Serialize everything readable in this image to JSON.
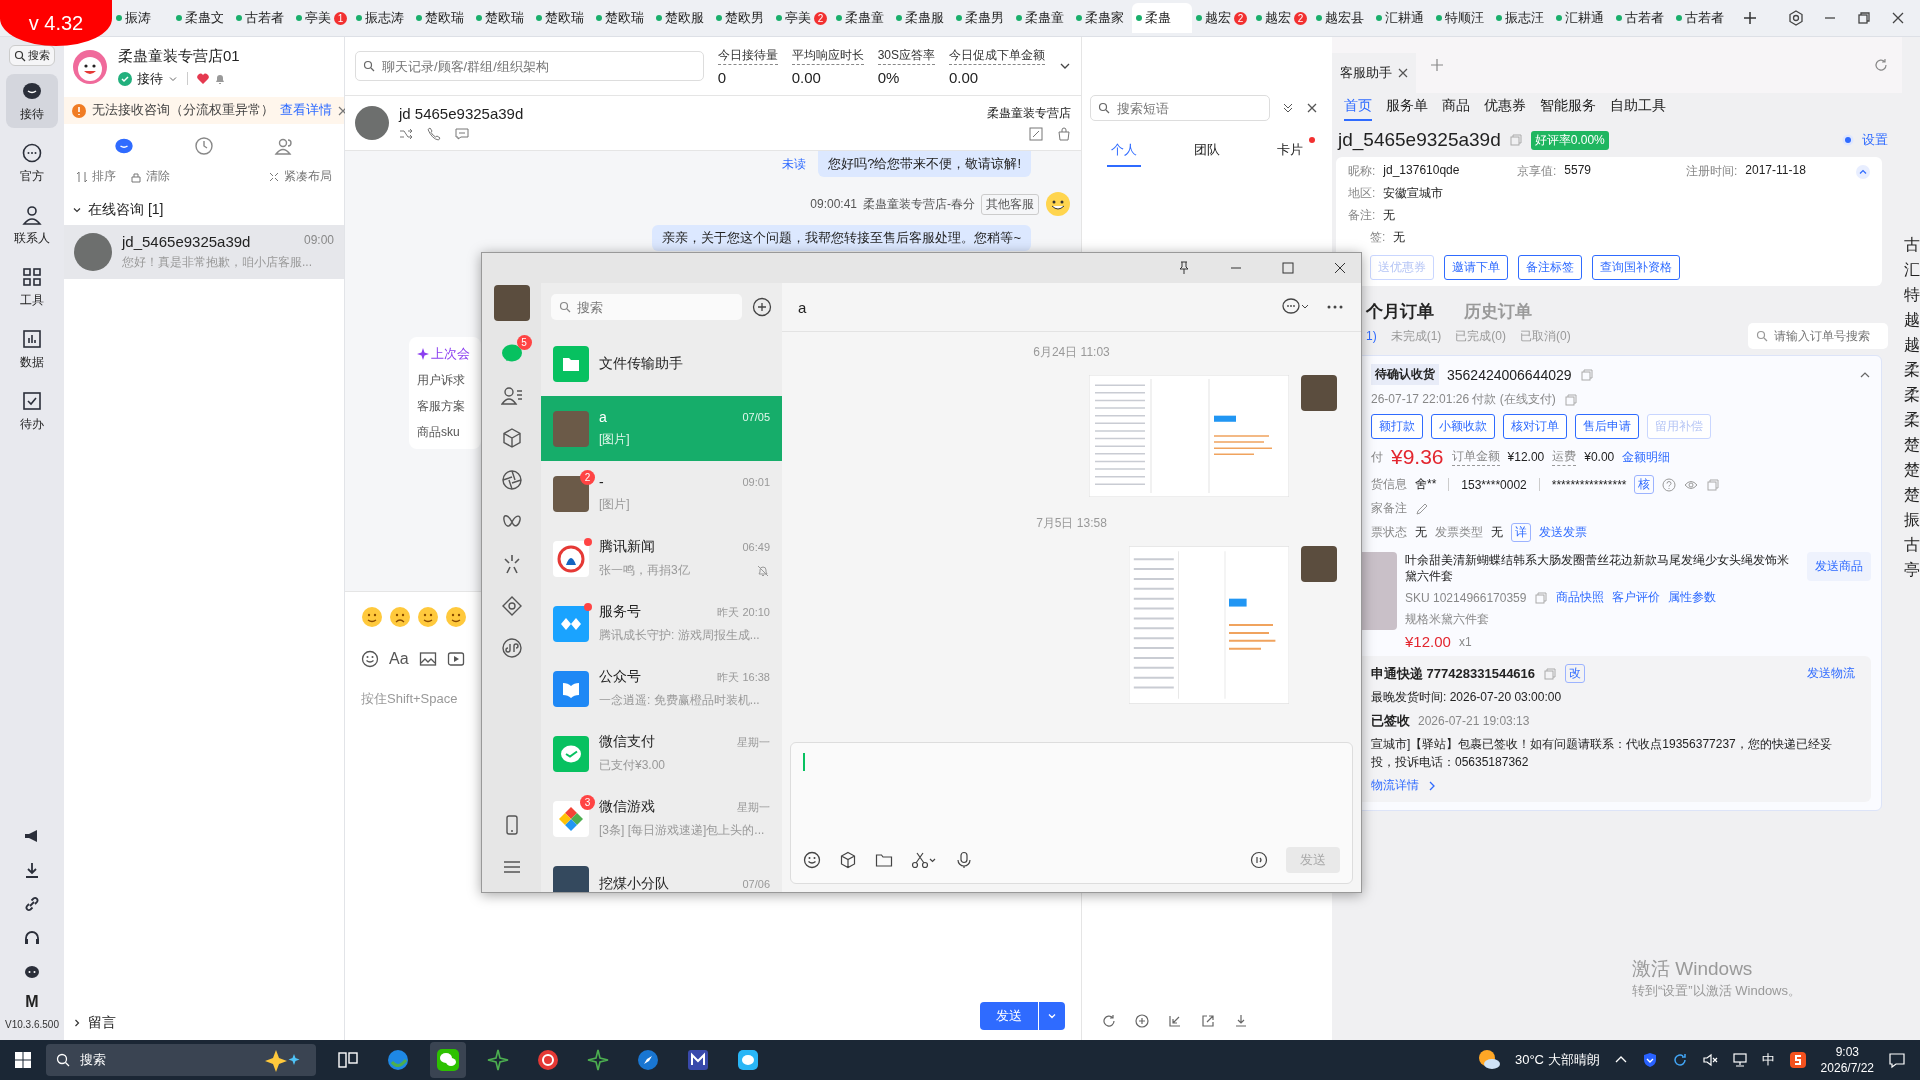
{
  "version_badge": "v 4.32",
  "top_tabs": [
    {
      "label": "振涛",
      "selected": false
    },
    {
      "label": "柔蛊文",
      "selected": false
    },
    {
      "label": "古若者",
      "selected": false
    },
    {
      "label": "亭美",
      "selected": false,
      "badge": "1"
    },
    {
      "label": "振志涛",
      "selected": false
    },
    {
      "label": "楚欧瑞",
      "selected": false
    },
    {
      "label": "楚欧瑞",
      "selected": false
    },
    {
      "label": "楚欧瑞",
      "selected": false
    },
    {
      "label": "楚欧瑞",
      "selected": false
    },
    {
      "label": "楚欧服",
      "selected": false
    },
    {
      "label": "楚欧男",
      "selected": false
    },
    {
      "label": "亭美",
      "selected": false,
      "badge": "2"
    },
    {
      "label": "柔蛊童",
      "selected": false
    },
    {
      "label": "柔蛊服",
      "selected": false
    },
    {
      "label": "柔蛊男",
      "selected": false
    },
    {
      "label": "柔蛊童",
      "selected": false
    },
    {
      "label": "柔蛊家",
      "selected": false
    },
    {
      "label": "柔蛊",
      "selected": true
    },
    {
      "label": "越宏",
      "selected": false,
      "badge": "2"
    },
    {
      "label": "越宏",
      "selected": false,
      "badge": "2"
    },
    {
      "label": "越宏县",
      "selected": false
    },
    {
      "label": "汇耕通",
      "selected": false
    },
    {
      "label": "特顺汪",
      "selected": false
    },
    {
      "label": "振志汪",
      "selected": false
    },
    {
      "label": "汇耕通",
      "selected": false
    },
    {
      "label": "古若者",
      "selected": false
    },
    {
      "label": "古若者",
      "selected": false
    }
  ],
  "rail": {
    "search": "搜索",
    "items": [
      {
        "kind": "chat",
        "label": "接待",
        "selected": true
      },
      {
        "kind": "official",
        "label": "官方",
        "selected": false
      },
      {
        "kind": "contacts",
        "label": "联系人",
        "selected": false
      },
      {
        "kind": "tools",
        "label": "工具",
        "selected": false
      },
      {
        "kind": "data",
        "label": "数据",
        "selected": false
      },
      {
        "kind": "todo",
        "label": "待办",
        "selected": false
      }
    ],
    "bottom_label": "M",
    "version": "V10.3.6.500"
  },
  "shop": {
    "name": "柔蛊童装专营店01",
    "status": "接待"
  },
  "warning": {
    "text": "无法接收咨询（分流权重异常）",
    "link": "查看详情"
  },
  "list_tabs": [
    {
      "kind": "chat",
      "selected": true
    },
    {
      "kind": "history",
      "selected": false
    },
    {
      "kind": "contacts",
      "selected": false
    }
  ],
  "list_actions": [
    {
      "kind": "sort",
      "label": "排序"
    },
    {
      "kind": "clear",
      "label": "清除"
    },
    {
      "kind": "compact",
      "label": "紧凑布局"
    }
  ],
  "group": {
    "label": "在线咨询 [1]",
    "expanded": true
  },
  "sessions": [
    {
      "name": "jd_5465e9325a39d",
      "time": "09:00",
      "preview": "您好！真是非常抱歉，咱小店客服...",
      "selected": true
    }
  ],
  "footer_group": "留言",
  "center": {
    "search": {
      "placeholder": "聊天记录/顾客/群组/组织架构"
    },
    "stats": [
      {
        "label": "今日接待量",
        "value": "0"
      },
      {
        "label": "平均响应时长",
        "value": "0.00"
      },
      {
        "label": "30S应答率",
        "value": "0%"
      },
      {
        "label": "今日促成下单金额",
        "value": "0.00"
      }
    ],
    "chat_name": "jd 5465e9325a39d",
    "chat_shop": "柔蛊童装专营店",
    "messages": [
      {
        "kind": "bubble",
        "unread": "未读",
        "text": "您好吗?给您带来不便，敬请谅解!"
      },
      {
        "kind": "meta",
        "time": "09:00:41",
        "sender": "柔蛊童装专营店-春分",
        "tag": "其他客服"
      },
      {
        "kind": "bubble",
        "text": "亲亲，关于您这个问题，我帮您转接至售后客服处理。您稍等~"
      }
    ],
    "summary_card": {
      "title": "上次会",
      "rows": [
        "用户诉求",
        "客服方案",
        "商品sku"
      ]
    },
    "format_button": "Aa",
    "input_hint": "按住Shift+Space",
    "send": "发送"
  },
  "phrases": {
    "placeholder": "搜索短语",
    "tabs": [
      {
        "label": "个人",
        "selected": true,
        "dot": false
      },
      {
        "label": "团队",
        "selected": false,
        "dot": false
      },
      {
        "label": "卡片",
        "selected": false,
        "dot": true
      }
    ]
  },
  "assistant": {
    "tab": "客服助手",
    "nav": [
      {
        "label": "首页",
        "selected": true
      },
      {
        "label": "服务单",
        "selected": false
      },
      {
        "label": "商品",
        "selected": false
      },
      {
        "label": "优惠券",
        "selected": false
      },
      {
        "label": "智能服务",
        "selected": false
      },
      {
        "label": "自助工具",
        "selected": false
      }
    ],
    "user": "jd_5465e9325a39d",
    "rating": "好评率0.00%",
    "settings": "设置",
    "info": [
      [
        {
          "label": "昵称:",
          "value": "jd_137610qde"
        },
        {
          "label": "京享值:",
          "value": "5579"
        },
        {
          "label": "注册时间:",
          "value": "2017-11-18"
        }
      ],
      [
        {
          "label": "地区:",
          "value": "安徽宣城市"
        }
      ],
      [
        {
          "label": "备注:",
          "value": "无"
        }
      ],
      [
        {
          "label": "签:",
          "value": "无"
        }
      ]
    ],
    "actions": [
      {
        "label": "送优惠券",
        "disabled": true
      },
      {
        "label": "邀请下单",
        "disabled": false
      },
      {
        "label": "备注标签",
        "disabled": false
      },
      {
        "label": "查询国补资格",
        "disabled": false
      }
    ],
    "order_tabs": [
      {
        "label": "个月订单",
        "selected": true
      },
      {
        "label": "历史订单",
        "selected": false
      }
    ],
    "order_filters": [
      {
        "label": "1)",
        "selected": true
      },
      {
        "label": "未完成(1)",
        "selected": false
      },
      {
        "label": "已完成(0)",
        "selected": false
      },
      {
        "label": "已取消(0)",
        "selected": false
      }
    ],
    "order_search": {
      "placeholder": "请输入订单号搜索"
    },
    "order": {
      "status": "待确认收货",
      "number": "3562424006644029",
      "paid": "26-07-17 22:01:26 付款 (在线支付)",
      "buttons": [
        {
          "label": "额打款",
          "disabled": false
        },
        {
          "label": "小额收款",
          "disabled": false
        },
        {
          "label": "核对订单",
          "disabled": false
        },
        {
          "label": "售后申请",
          "disabled": false
        },
        {
          "label": "留用补偿",
          "disabled": true
        }
      ],
      "paid_label": "付",
      "paid_amount": "¥9.36",
      "total_label": "订单金额",
      "total": "¥12.00",
      "freight_label": "运费",
      "freight": "¥0.00",
      "detail_link": "金额明细",
      "receiver_label": "货信息",
      "receiver": "舍**",
      "phone": "153****0002",
      "address": "****************",
      "verify": "核",
      "remark_label": "家备注",
      "invoice_label": "票状态",
      "invoice": "无",
      "invoice_type_label": "发票类型",
      "invoice_type": "无",
      "invoice_detail": "详",
      "send_invoice": "发送发票",
      "product": {
        "title": "叶余甜美清新蝴蝶结韩系大肠发圈蕾丝花边新款马尾发绳少女头绳发饰米黛六件套",
        "sku": "SKU 10214966170359",
        "links": [
          "商品快照",
          "客户评价",
          "属性参数"
        ],
        "spec": "规格米黛六件套",
        "price": "¥12.00",
        "qty": "x1",
        "send": "发送商品"
      },
      "logistics": {
        "carrier": "申通快递 777428331544616",
        "edit": "改",
        "send": "发送物流",
        "deadline": "最晚发货时间:  2026-07-20 03:00:00",
        "state": "已签收",
        "state_time": "2026-07-21 19:03:13",
        "message": "宣城市]【驿站】包裹已签收！如有问题请联系：代收点19356377237，您的快递已经妥投，投诉电话：05635187362",
        "link": "物流详情"
      }
    }
  },
  "side_strip": [
    "古",
    "汇",
    "特",
    "越",
    "越",
    "柔",
    "柔",
    "柔",
    "楚",
    "楚",
    "楚",
    "振",
    "古",
    "亭"
  ],
  "os_notice": {
    "title": "激活 Windows",
    "text": "转到“设置”以激活 Windows。"
  },
  "wechat": {
    "search": {
      "placeholder": "搜索"
    },
    "rail_badge": "5",
    "chats": [
      {
        "kind": "file",
        "name": "文件传输助手",
        "selected": false,
        "dot": false,
        "muted": false
      },
      {
        "kind": "photo",
        "name": "a",
        "time": "07/05",
        "preview": "[图片]",
        "selected": true,
        "dot": false,
        "muted": false
      },
      {
        "kind": "photo",
        "name": "-",
        "time": "09:01",
        "preview": "[图片]",
        "badge": "2",
        "selected": false,
        "dot": false,
        "muted": false
      },
      {
        "kind": "news",
        "name": "腾讯新闻",
        "time": "06:49",
        "preview": "张一鸣，再捐3亿",
        "selected": false,
        "dot": true,
        "muted": true
      },
      {
        "kind": "service",
        "name": "服务号",
        "time": "昨天 20:10",
        "preview": "腾讯成长守护: 游戏周报生成...",
        "selected": false,
        "dot": true,
        "muted": false
      },
      {
        "kind": "official",
        "name": "公众号",
        "time": "昨天 16:38",
        "preview": "一念逍遥: 免费赢橙品时装机...",
        "selected": false,
        "dot": false,
        "muted": false
      },
      {
        "kind": "pay",
        "name": "微信支付",
        "time": "星期一",
        "preview": "已支付¥3.00",
        "selected": false,
        "dot": false,
        "muted": false
      },
      {
        "kind": "game",
        "name": "微信游戏",
        "time": "星期一",
        "preview": "[3条] [每日游戏速递]包上头的...",
        "badge": "3",
        "selected": false,
        "dot": false,
        "muted": false
      },
      {
        "kind": "group",
        "name": "挖煤小分队",
        "time": "07/06",
        "selected": false,
        "dot": false,
        "muted": false
      }
    ],
    "chat_title": "a",
    "history": [
      {
        "time": "6月24日 11:03"
      },
      {
        "time": "7月5日 13:58"
      }
    ],
    "send": "发送"
  },
  "taskbar": {
    "search": "搜索",
    "weather": "30°C  大部晴朗",
    "ime": "中",
    "time": "9:03",
    "date": "2026/7/22",
    "apps": [
      {
        "kind": "taskview",
        "selected": false
      },
      {
        "kind": "edge",
        "selected": false
      },
      {
        "kind": "wechat",
        "selected": true
      },
      {
        "kind": "star",
        "selected": false
      },
      {
        "kind": "red",
        "selected": false
      },
      {
        "kind": "star",
        "selected": false
      },
      {
        "kind": "compass",
        "selected": false
      },
      {
        "kind": "m",
        "selected": false
      },
      {
        "kind": "chatapp",
        "selected": false
      }
    ]
  }
}
